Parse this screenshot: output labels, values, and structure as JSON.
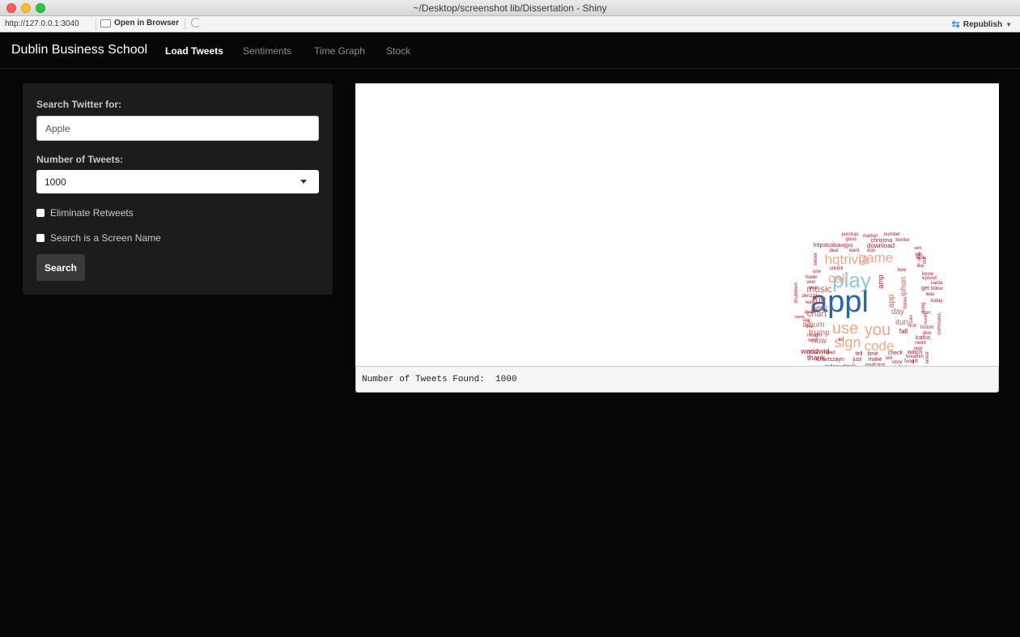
{
  "window": {
    "title": "~/Desktop/screenshot lib/Dissertation - Shiny"
  },
  "addressbar": {
    "url": "http://127.0.0.1:3040",
    "open_in_browser": "Open in Browser",
    "republish": "Republish"
  },
  "navbar": {
    "brand": "Dublin Business School",
    "tabs": [
      {
        "label": "Load Tweets",
        "active": true
      },
      {
        "label": "Sentiments",
        "active": false
      },
      {
        "label": "Time Graph",
        "active": false
      },
      {
        "label": "Stock",
        "active": false
      }
    ]
  },
  "sidebar": {
    "search_label": "Search Twitter for:",
    "search_value": "Apple",
    "count_label": "Number of Tweets:",
    "count_value": "1000",
    "eliminate_retweets": "Eliminate Retweets",
    "screen_name": "Search is a Screen Name",
    "search_button": "Search"
  },
  "wordcloud": {
    "colors": {
      "dark_blue": "#2166ac",
      "light_blue": "#92c5de",
      "peach": "#f4a582",
      "red": "#d6604d",
      "dark_red": "#b2182b"
    },
    "words": [
      {
        "text": "appl",
        "color": "dark_blue"
      },
      {
        "text": "play",
        "color": "light_blue"
      },
      {
        "text": "you",
        "color": "peach"
      },
      {
        "text": "use",
        "color": "peach"
      },
      {
        "text": "sign",
        "color": "peach"
      },
      {
        "text": "code",
        "color": "peach"
      },
      {
        "text": "hqtrivia",
        "color": "peach"
      },
      {
        "text": "game",
        "color": "peach"
      },
      {
        "text": "call",
        "color": "peach"
      },
      {
        "text": "music",
        "color": "red"
      },
      {
        "text": "the",
        "color": "red"
      },
      {
        "text": "new",
        "color": "red"
      },
      {
        "text": "chart",
        "color": "red"
      },
      {
        "text": "album",
        "color": "red"
      },
      {
        "text": "trump",
        "color": "red"
      },
      {
        "text": "now",
        "color": "red"
      },
      {
        "text": "worldwid",
        "color": "dark_red"
      },
      {
        "text": "thank",
        "color": "dark_red"
      },
      {
        "text": "iphon",
        "color": "red"
      },
      {
        "text": "app",
        "color": "red"
      },
      {
        "text": "amp",
        "color": "dark_red"
      },
      {
        "text": "day",
        "color": "red"
      },
      {
        "text": "itun",
        "color": "red"
      },
      {
        "text": "fall",
        "color": "dark_red"
      },
      {
        "text": "download",
        "color": "dark_red"
      },
      {
        "text": "httpstcobiavgyu",
        "color": "dark_red"
      },
      {
        "text": "christma",
        "color": "dark_red"
      },
      {
        "text": "deal",
        "color": "dark_red"
      },
      {
        "text": "want",
        "color": "dark_red"
      },
      {
        "text": "don",
        "color": "dark_red"
      },
      {
        "text": "purchas",
        "color": "dark_red"
      },
      {
        "text": "market",
        "color": "dark_red"
      },
      {
        "text": "number",
        "color": "dark_red"
      },
      {
        "text": "good",
        "color": "dark_red"
      },
      {
        "text": "border",
        "color": "dark_red"
      },
      {
        "text": "unlock",
        "color": "dark_red"
      },
      {
        "text": "one",
        "color": "dark_red"
      },
      {
        "text": "made",
        "color": "dark_red"
      },
      {
        "text": "year",
        "color": "dark_red"
      },
      {
        "text": "wall",
        "color": "dark_red"
      },
      {
        "text": "avail",
        "color": "dark_red"
      },
      {
        "text": "love",
        "color": "dark_red"
      },
      {
        "text": "know",
        "color": "dark_red"
      },
      {
        "text": "episod",
        "color": "dark_red"
      },
      {
        "text": "get",
        "color": "dark_red"
      },
      {
        "text": "follow",
        "color": "dark_red"
      },
      {
        "text": "leav",
        "color": "dark_red"
      },
      {
        "text": "today",
        "color": "dark_red"
      },
      {
        "text": "like",
        "color": "dark_red"
      },
      {
        "text": "santa",
        "color": "dark_red"
      },
      {
        "text": "tell",
        "color": "dark_red"
      },
      {
        "text": "time",
        "color": "dark_red"
      },
      {
        "text": "check",
        "color": "dark_red"
      },
      {
        "text": "watch",
        "color": "dark_red"
      },
      {
        "text": "just",
        "color": "dark_red"
      },
      {
        "text": "make",
        "color": "dark_red"
      },
      {
        "text": "will",
        "color": "dark_red"
      },
      {
        "text": "podcast",
        "color": "dark_red"
      },
      {
        "text": "sidekick",
        "color": "dark_red"
      },
      {
        "text": "chartszayn",
        "color": "dark_red"
      },
      {
        "text": "redcouchtalk",
        "color": "dark_red"
      },
      {
        "text": "httpstcoaavjgwhubi",
        "color": "dark_red"
      },
      {
        "text": "qualcomm",
        "color": "dark_red"
      },
      {
        "text": "free",
        "color": "dark_red"
      },
      {
        "text": "govern",
        "color": "dark_red"
      },
      {
        "text": "icarus",
        "color": "dark_red"
      },
      {
        "text": "histori",
        "color": "dark_red"
      },
      {
        "text": "give",
        "color": "dark_red"
      },
      {
        "text": "first",
        "color": "dark_red"
      },
      {
        "text": "imagin",
        "color": "dark_red"
      },
      {
        "text": "best",
        "color": "dark_red"
      },
      {
        "text": "close",
        "color": "dark_red"
      },
      {
        "text": "ipad",
        "color": "dark_red"
      },
      {
        "text": "denzzz",
        "color": "dark_red"
      },
      {
        "text": "say",
        "color": "dark_red"
      },
      {
        "text": "week",
        "color": "dark_red"
      },
      {
        "text": "this",
        "color": "dark_red"
      },
      {
        "text": "won",
        "color": "dark_red"
      },
      {
        "text": "let",
        "color": "dark_red"
      },
      {
        "text": "with",
        "color": "dark_red"
      },
      {
        "text": "win",
        "color": "dark_red"
      },
      {
        "text": "tech",
        "color": "dark_red"
      },
      {
        "text": "still",
        "color": "dark_red"
      },
      {
        "text": "next",
        "color": "dark_red"
      },
      {
        "text": "store",
        "color": "dark_red"
      },
      {
        "text": "breathin",
        "color": "dark_red"
      },
      {
        "text": "fund",
        "color": "dark_red"
      },
      {
        "text": "gift",
        "color": "dark_red"
      },
      {
        "text": "need",
        "color": "dark_red"
      },
      {
        "text": "can",
        "color": "dark_red"
      },
      {
        "text": "song",
        "color": "dark_red"
      },
      {
        "text": "communic",
        "color": "dark_red"
      },
      {
        "text": "shutdown",
        "color": "dark_red"
      },
      {
        "text": "listen",
        "color": "dark_red"
      },
      {
        "text": "arrest",
        "color": "dark_red"
      },
      {
        "text": "senior",
        "color": "dark_red"
      },
      {
        "text": "stori",
        "color": "dark_red"
      },
      {
        "text": "month",
        "color": "dark_red"
      },
      {
        "text": "news",
        "color": "dark_red"
      }
    ]
  },
  "output": {
    "tweets_found": "Number of Tweets Found:  1000"
  }
}
